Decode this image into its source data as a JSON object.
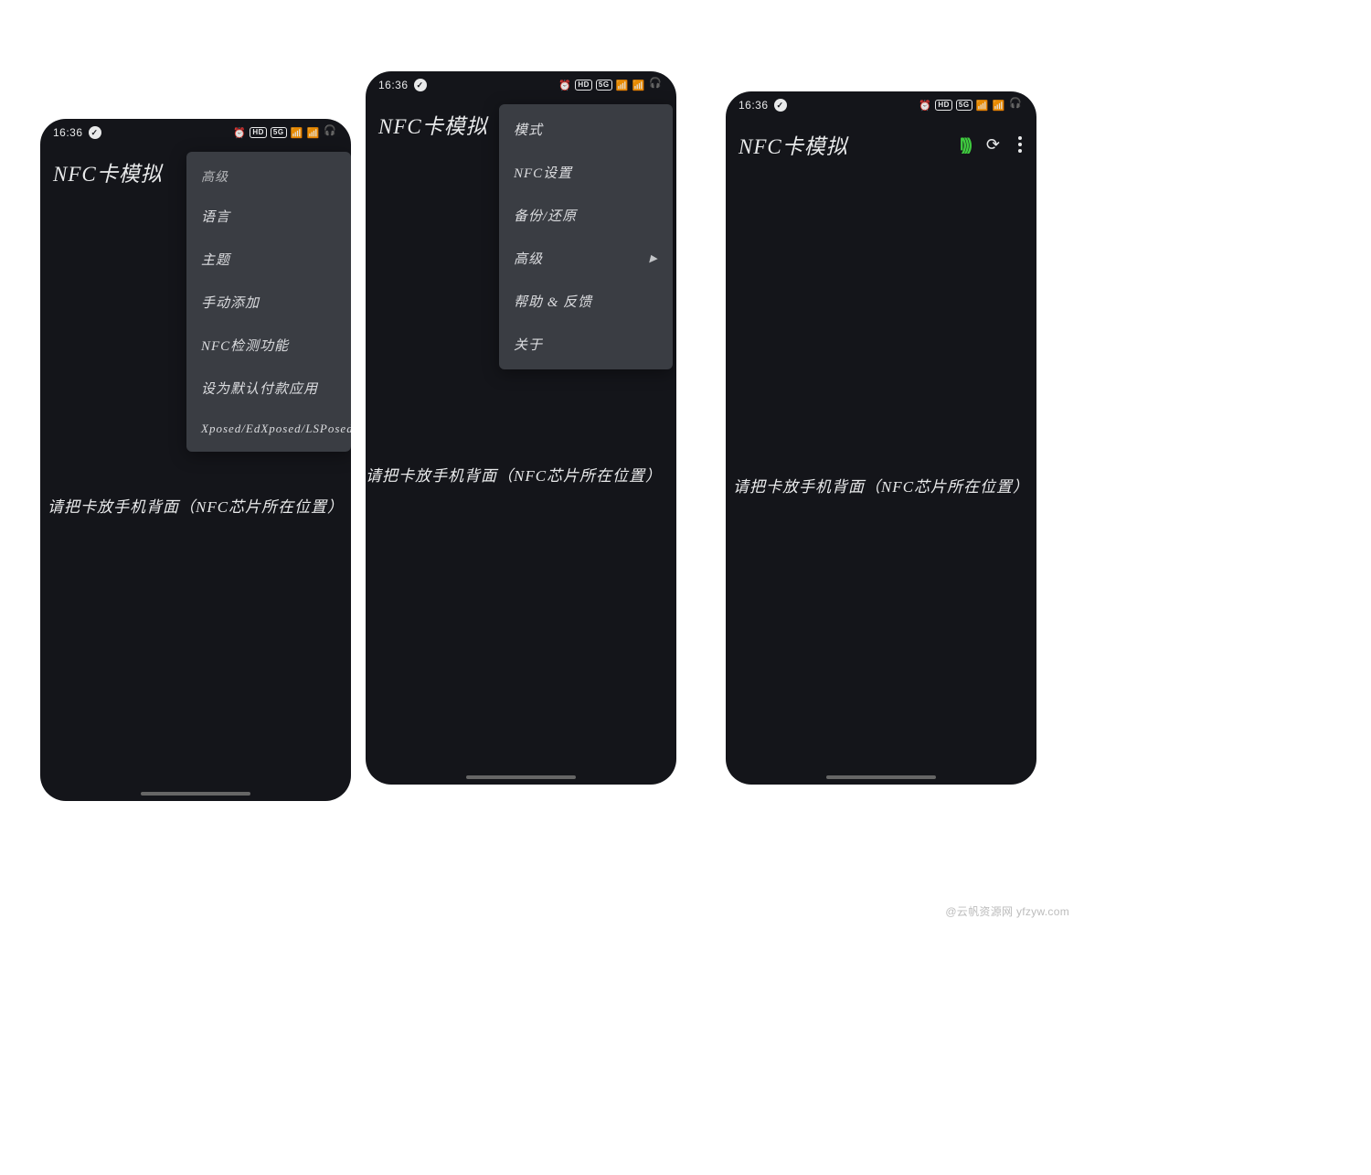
{
  "status": {
    "time": "16:36",
    "hd": "HD",
    "fiveg": "5G"
  },
  "app_title": "NFC卡模拟",
  "instruction_text": "请把卡放手机背面（NFC芯片所在位置）",
  "menu1": {
    "header": "高级",
    "items": [
      "语言",
      "主题",
      "手动添加",
      "NFC检测功能",
      "设为默认付款应用",
      "Xposed/EdXposed/LSPosed"
    ]
  },
  "menu2": {
    "items": [
      {
        "label": "模式",
        "arrow": false
      },
      {
        "label": "NFC设置",
        "arrow": false
      },
      {
        "label": "备份/还原",
        "arrow": false
      },
      {
        "label": "高级",
        "arrow": true
      },
      {
        "label": "帮助 & 反馈",
        "arrow": false
      },
      {
        "label": "关于",
        "arrow": false
      }
    ]
  },
  "watermark": "@云帆资源网 yfzyw.com"
}
